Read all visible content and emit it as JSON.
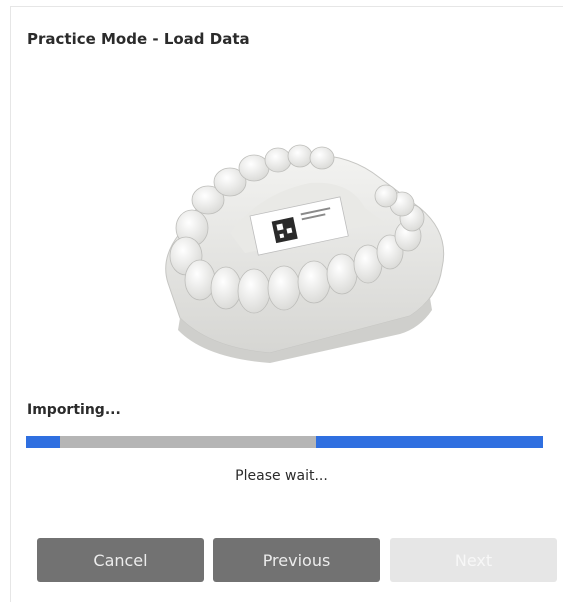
{
  "dialog": {
    "title": "Practice Mode - Load Data"
  },
  "illustration": {
    "icon": "dental-arch-model-image"
  },
  "progress": {
    "status_label": "Importing...",
    "message": "Please wait...",
    "indeterminate": true,
    "bar_color": "#2f6fe0",
    "track_color": "#b5b5b5"
  },
  "buttons": {
    "cancel": "Cancel",
    "previous": "Previous",
    "next": "Next",
    "next_enabled": false
  }
}
